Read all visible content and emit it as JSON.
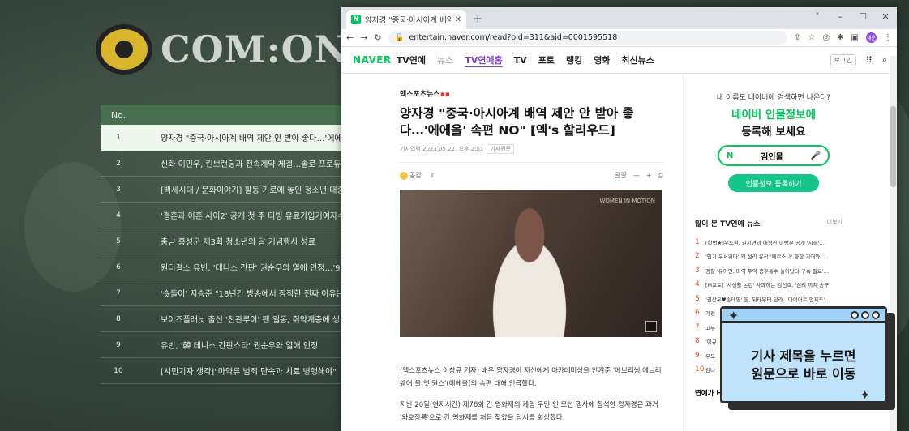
{
  "background": {
    "logo_text": "COM:ONEW",
    "table_header": "No.",
    "rows": [
      {
        "no": "1",
        "title": "양자경 \"중국·아시아계 배역 제안 안 받아 좋다…'에에올' 속편"
      },
      {
        "no": "2",
        "title": "신화 이민우, 린브랜딩과 전속계약 체결…솔로·프로듀서 활동"
      },
      {
        "no": "3",
        "title": "[백세시대 / 문화이야기] 활동 기로에 놓인 청소년 대중문화"
      },
      {
        "no": "4",
        "title": "'결혼과 이혼 사이2' 공개 첫 주 티빙 유료가입기여자수 1위"
      },
      {
        "no": "5",
        "title": "충남 홍성군 제3회 청소년의 달 기념행사 성료"
      },
      {
        "no": "6",
        "title": "원더걸스 유빈, '테니스 간판' 권순우와 열애 인정…'9살 연상"
      },
      {
        "no": "7",
        "title": "'슛돌이' 지승준 \"18년간 방송에서 잠적한 진짜 이유는\"(강심"
      },
      {
        "no": "8",
        "title": "보이즈플래닛 출신 '천관루이' 팬 일동, 취약계층에 생리대와"
      },
      {
        "no": "9",
        "title": "유빈, '韓 테니스 간판스타' 권순우와 열애 인정"
      },
      {
        "no": "10",
        "title": "[시민기자 생각]\"마약류 범죄 단속과 치료 병행해야\""
      }
    ]
  },
  "browser": {
    "tab_title": "양자경 \"중국·아시아계 배역 제안 \"",
    "tab_icon": "N",
    "url": "entertain.naver.com/read?oid=311&aid=0001595518",
    "profile_label": "재운",
    "window_controls": [
      "˅",
      "–",
      "☐",
      "✕"
    ]
  },
  "naver": {
    "logo": "NAVER",
    "service": "TV연예",
    "nav": [
      "뉴스",
      "TV연예홈",
      "TV",
      "포토",
      "랭킹",
      "영화",
      "최신뉴스"
    ],
    "login": "로그인"
  },
  "article": {
    "press": "엑스포츠뉴스",
    "headline": "양자경 \"중국·아시아계 배역 제안 안 받아 좋다…'에에올' 속편 NO\" [엑's 할리우드]",
    "date": "기사입력 2023.05.22. 오후 2:51",
    "origin_label": "기사원문",
    "like_label": "공감",
    "font_label": "글꼴",
    "photo_watermark": "WOMEN IN MOTION",
    "lead_1": "(엑스포츠뉴스 이창규 기자) 배우 양자경이 자신에게 아카데미상을 안겨준 '에브리씽 에브리웨어 올 앳 원스'(에에올)의 속편 대해 언급했다.",
    "lead_2": "지난 20일(현지시간) 제76회 칸 영화제의 케링 우먼 인 모션 행사에 참석한 양자경은 과거 '와호장룡'으로 칸 영화제를 처음 찾았을 당시를 회상했다."
  },
  "sidebar": {
    "promo_top": "내 이름도 네이버에 검색하면 나온다?",
    "promo_line1": "네이버 인물정보에",
    "promo_line2": "등록해 보세요",
    "promo_search_value": "김인물",
    "promo_search_n": "N",
    "promo_button": "인물정보 등록하기",
    "rank_title": "많이 본 TV연예 뉴스",
    "rank_more": "더보기",
    "rank": [
      {
        "num": "1",
        "title": "[합법★]우도환, 김지연과 애정신 미방분 공개 '시끌'…"
      },
      {
        "num": "2",
        "title": "'인기 우서워다' 왜 설리 유작 '페르소나' 향한 기대와…"
      },
      {
        "num": "3",
        "title": "경찰 '유아인, 마약 투약 증후통수 늘어났다.구속 필요'…"
      },
      {
        "num": "4",
        "title": "[M포토] '사생활 논란' 사과하는 김선호, '심려 끼쳐 송구'"
      },
      {
        "num": "5",
        "title": "'권상우♥손태영' 딸, 뒤태부터 달라…다이어트 언제도'…"
      },
      {
        "num": "6",
        "title": "가정"
      },
      {
        "num": "7",
        "title": "고두"
      },
      {
        "num": "8",
        "title": "'이규"
      },
      {
        "num": "9",
        "title": "우도"
      },
      {
        "num": "10",
        "title": "김나"
      }
    ],
    "section2_title": "연예가 H"
  },
  "tooltip": {
    "line1": "기사 제목을 누르면",
    "line2": "원문으로 바로 이동"
  },
  "colors": {
    "naver_green": "#03c75a",
    "active_nav": "#7b3fc7",
    "tooltip_bg": "#bfe3fb"
  }
}
